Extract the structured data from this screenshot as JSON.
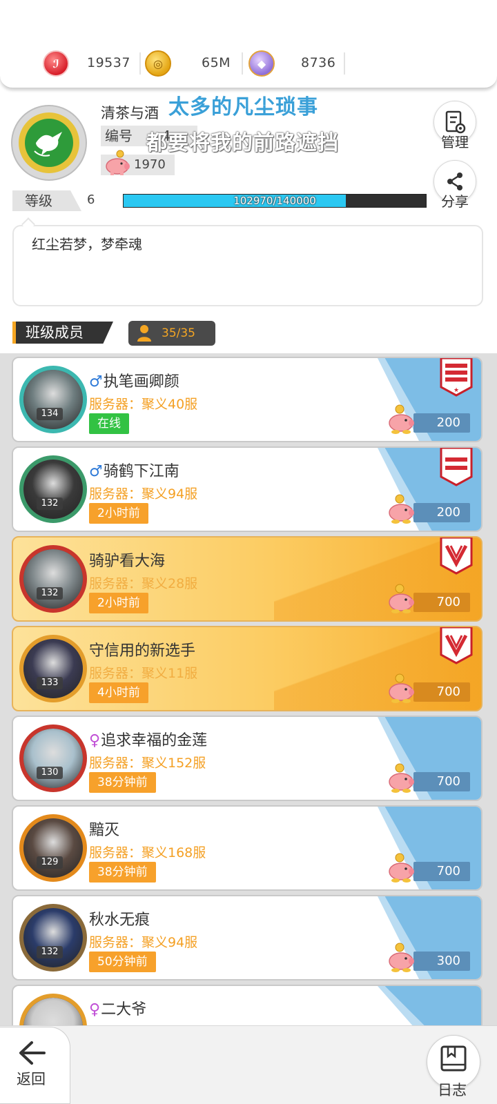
{
  "currencies": [
    {
      "name": "ruby-token",
      "value": "19537"
    },
    {
      "name": "gold-coin",
      "value": "65M"
    },
    {
      "name": "diamond-ring",
      "value": "8736"
    }
  ],
  "profile": {
    "nickname": "清茶与酒",
    "id_label": "编号",
    "id_partial": "4",
    "pig_coins": "1970",
    "level_label": "等级",
    "level": "6",
    "xp_text": "102970/140000",
    "xp_fraction": 0.7355,
    "motto": "红尘若梦，梦牵魂"
  },
  "lyrics": {
    "line1": "太多的凡尘琐事",
    "line2": "都要将我的前路遮挡"
  },
  "actions": {
    "manage": "管理",
    "share": "分享"
  },
  "members_section": {
    "title": "班级成员",
    "count": "35/35"
  },
  "members": [
    {
      "sex": "♂",
      "sex_type": "m",
      "name": "执笔画卿颜",
      "server": "服务器：聚义40服",
      "status": "在线",
      "online": true,
      "level": "134",
      "coins": "200",
      "gold": false,
      "badge": "red-flag-star",
      "ring_color": "#3cb8b0",
      "face_color": "#6e7d7f"
    },
    {
      "sex": "♂",
      "sex_type": "m",
      "name": "骑鹤下江南",
      "server": "服务器：聚义94服",
      "status": "2小时前",
      "online": false,
      "level": "132",
      "coins": "200",
      "gold": false,
      "badge": "red-flag",
      "ring_color": "#3b9a6a",
      "face_color": "#3a3a3a"
    },
    {
      "sex": "",
      "sex_type": "m",
      "name": "骑驴看大海",
      "server": "服务器：聚义28服",
      "status": "2小时前",
      "online": false,
      "level": "132",
      "coins": "700",
      "gold": true,
      "badge": "red-shield",
      "ring_color": "#c8352c",
      "face_color": "#7e878a"
    },
    {
      "sex": "",
      "sex_type": "m",
      "name": "守信用的新选手",
      "server": "服务器：聚义11服",
      "status": "4小时前",
      "online": false,
      "level": "133",
      "coins": "700",
      "gold": true,
      "badge": "red-shield",
      "ring_color": "#e39d2b",
      "face_color": "#3b3b52"
    },
    {
      "sex": "♀",
      "sex_type": "f",
      "name": "追求幸福的金莲",
      "server": "服务器：聚义152服",
      "status": "38分钟前",
      "online": false,
      "level": "130",
      "coins": "700",
      "gold": false,
      "badge": "",
      "ring_color": "#c8352c",
      "face_color": "#a9c0cc"
    },
    {
      "sex": "",
      "sex_type": "m",
      "name": "黯灭",
      "server": "服务器：聚义168服",
      "status": "38分钟前",
      "online": false,
      "level": "129",
      "coins": "700",
      "gold": false,
      "badge": "",
      "ring_color": "#e38a1c",
      "face_color": "#5a4a42"
    },
    {
      "sex": "",
      "sex_type": "m",
      "name": "秋水无痕",
      "server": "服务器：聚义94服",
      "status": "50分钟前",
      "online": false,
      "level": "132",
      "coins": "300",
      "gold": false,
      "badge": "",
      "ring_color": "#8a6a3a",
      "face_color": "#2b3c6a"
    },
    {
      "sex": "♀",
      "sex_type": "f",
      "name": "二大爷",
      "server": "",
      "status": "",
      "online": false,
      "level": "",
      "coins": "",
      "gold": false,
      "badge": "",
      "ring_color": "#e39d2b",
      "face_color": "#cccccc"
    }
  ],
  "nav": {
    "back": "返回",
    "log": "日志"
  }
}
